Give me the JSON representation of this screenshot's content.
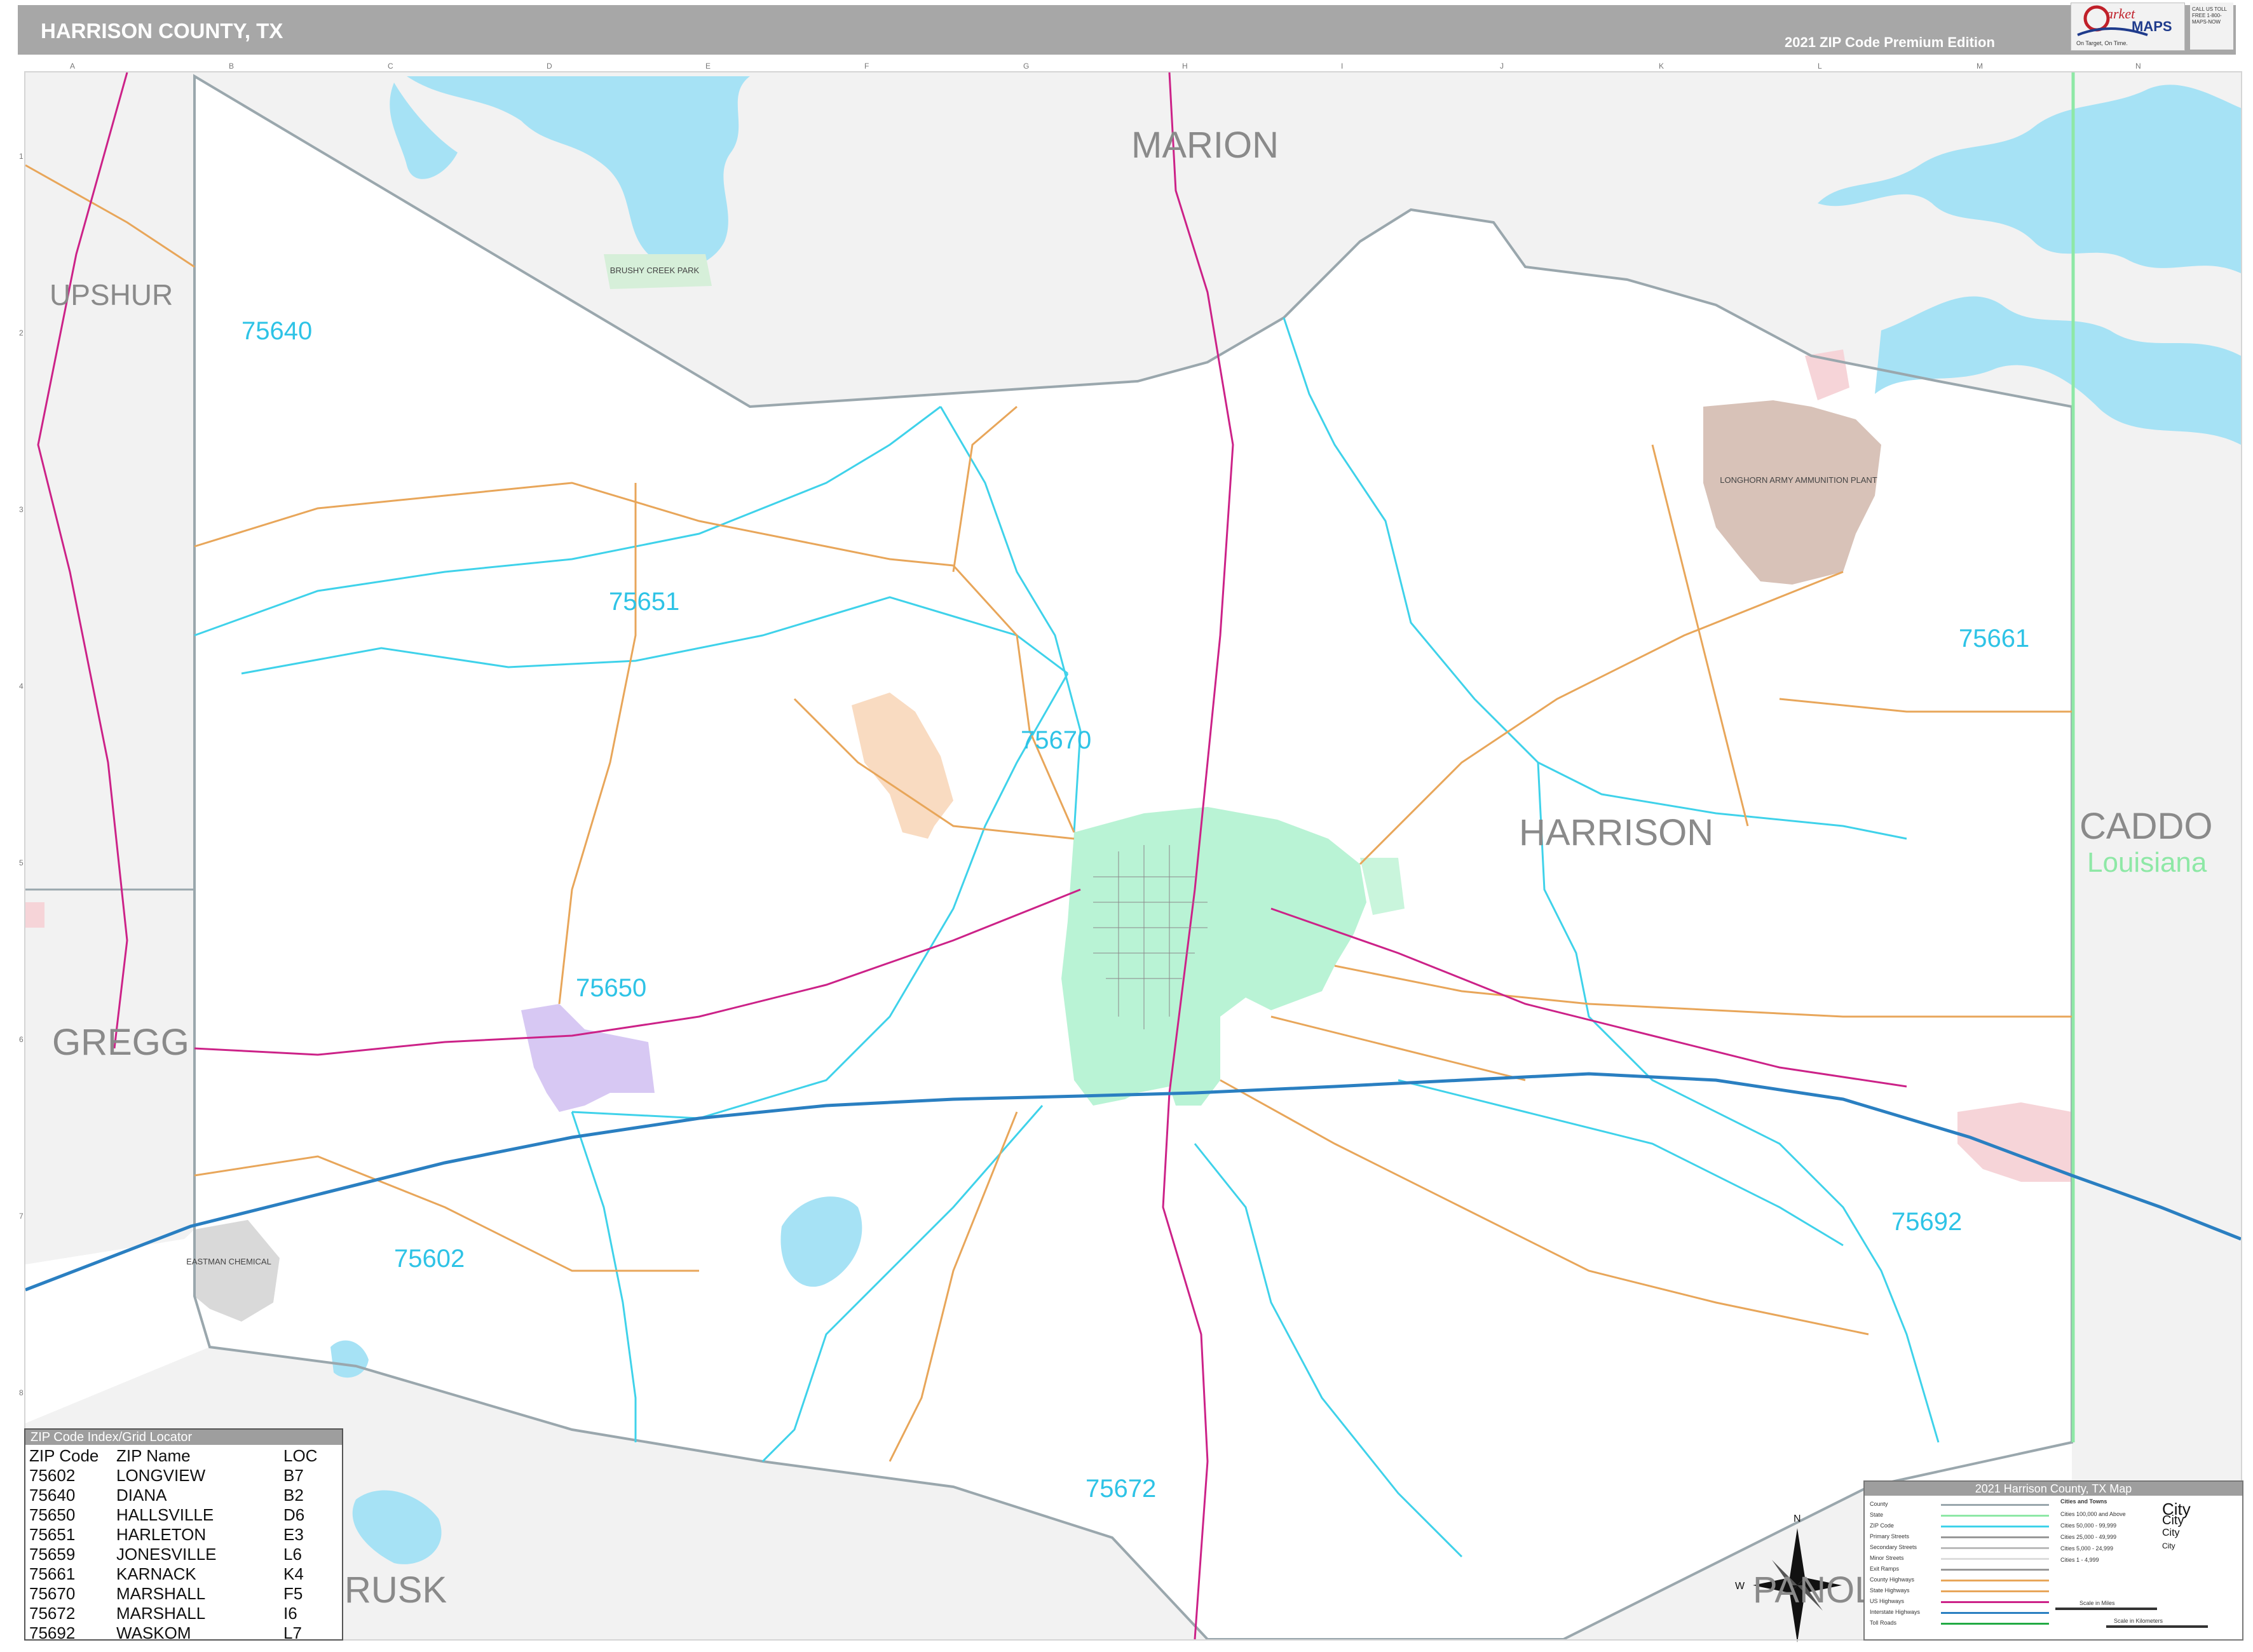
{
  "header": {
    "title": "HARRISON COUNTY, TX",
    "edition": "2021 ZIP Code Premium Edition",
    "logo_text": "Market MAPS",
    "logo_tagline": "On Target, On Time. America's Leading Source of Business Maps",
    "logo_contact": "CALL US TOLL FREE 1-800-MAPS-NOW"
  },
  "grid": {
    "columns": [
      "A",
      "B",
      "C",
      "D",
      "E",
      "F",
      "G",
      "H",
      "I",
      "J",
      "K",
      "L",
      "M",
      "N"
    ],
    "rows": [
      "1",
      "2",
      "3",
      "4",
      "5",
      "6",
      "7",
      "8"
    ]
  },
  "map_labels": {
    "counties": {
      "marion": "MARION",
      "upshur": "UPSHUR",
      "gregg": "GREGG",
      "rusk": "RUSK",
      "panola": "PANOLA",
      "harrison": "HARRISON",
      "caddo": "CADDO",
      "louisiana": "Louisiana"
    },
    "zips": {
      "z75640": "75640",
      "z75651": "75651",
      "z75670": "75670",
      "z75661": "75661",
      "z75650": "75650",
      "z75602": "75602",
      "z75692": "75692",
      "z75672": "75672"
    },
    "places": {
      "brushy_creek": "BRUSHY CREEK PARK",
      "longhorn": "LONGHORN ARMY AMMUNITION PLANT",
      "eastman": "EASTMAN CHEMICAL"
    }
  },
  "zip_index": {
    "title": "ZIP Code Index/Grid Locator",
    "headers": [
      "ZIP Code",
      "ZIP Name",
      "LOC"
    ],
    "rows": [
      [
        "75602",
        "LONGVIEW",
        "B7"
      ],
      [
        "75640",
        "DIANA",
        "B2"
      ],
      [
        "75650",
        "HALLSVILLE",
        "D6"
      ],
      [
        "75651",
        "HARLETON",
        "E3"
      ],
      [
        "75659",
        "JONESVILLE",
        "L6"
      ],
      [
        "75661",
        "KARNACK",
        "K4"
      ],
      [
        "75670",
        "MARSHALL",
        "F5"
      ],
      [
        "75672",
        "MARSHALL",
        "I6"
      ],
      [
        "75692",
        "WASKOM",
        "L7"
      ]
    ]
  },
  "legend": {
    "title": "2021 Harrison County, TX Map",
    "line_items": [
      "County",
      "State",
      "ZIP Code",
      "Primary Streets",
      "Secondary Streets",
      "Minor Streets",
      "Exit Ramps",
      "County Highways",
      "State Highways",
      "US Highways",
      "Interstate Highways",
      "Toll Roads"
    ],
    "city_header": "Cities and Towns",
    "city_items": [
      "Cities 100,000 and Above",
      "Cities 50,000 - 99,999",
      "Cities 25,000 - 49,999",
      "Cities 5,000 - 24,999",
      "Cities 1 - 4,999"
    ],
    "city_samples": [
      "City",
      "City",
      "City",
      "City"
    ],
    "compass_n": "N",
    "compass_w": "W",
    "scale_miles": "Scale in Miles",
    "scale_km": "Scale in Kilometers"
  },
  "colors": {
    "water": "#a6e2f5",
    "county_border": "#9aa7ad",
    "zip_border": "#3fd2ea",
    "interstate": "#2a7fc1",
    "us_highway": "#cc2288",
    "state_highway": "#e8a65a",
    "marshall_area": "#b9f3d5",
    "hallsville_area": "#d7c8f3",
    "waskom_area": "#f6d4d8",
    "longhorn_area": "#d8c2b8",
    "outside_county": "#f2f2f2",
    "louisiana_line": "#8ee8a6"
  }
}
